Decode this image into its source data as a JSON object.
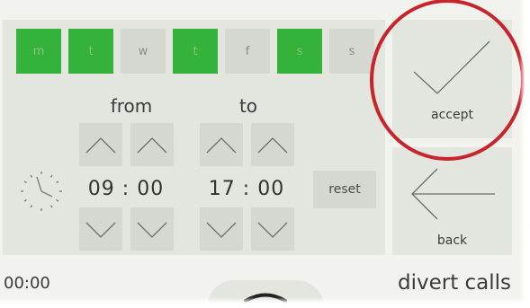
{
  "days": [
    {
      "label": "m",
      "active": true
    },
    {
      "label": "t",
      "active": true
    },
    {
      "label": "w",
      "active": false
    },
    {
      "label": "t",
      "active": true
    },
    {
      "label": "f",
      "active": false
    },
    {
      "label": "s",
      "active": true
    },
    {
      "label": "s",
      "active": false
    }
  ],
  "from": {
    "label": "from",
    "hour": "09",
    "minute": "00",
    "separator": ":"
  },
  "to": {
    "label": "to",
    "hour": "17",
    "minute": "00",
    "separator": ":"
  },
  "buttons": {
    "reset": "reset",
    "accept": "accept",
    "back": "back"
  },
  "status": {
    "clock_time": "00:00",
    "screen_title": "divert calls"
  },
  "colors": {
    "active_day": "#35b23a",
    "highlight_ring": "#c8242b"
  }
}
